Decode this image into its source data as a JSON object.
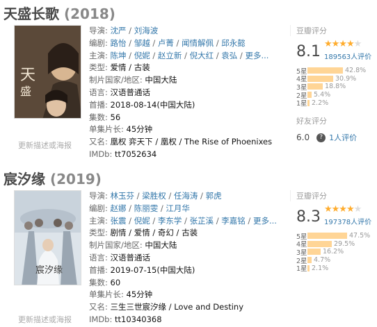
{
  "entries": [
    {
      "title": "天盛长歌",
      "year": "(2018)",
      "poster_link": "更新描述或海报",
      "director": {
        "label": "导演:",
        "names": [
          "沈严",
          "刘海波"
        ]
      },
      "writer": {
        "label": "编剧:",
        "names": [
          "路怡",
          "邹越",
          "卢菁",
          "闻情解佩",
          "邱永懿"
        ]
      },
      "cast": {
        "label": "主演:",
        "names": [
          "陈坤",
          "倪妮",
          "赵立新",
          "倪大红",
          "袁弘"
        ],
        "more": "更多..."
      },
      "genre": {
        "label": "类型:",
        "value": "爱情 / 古装"
      },
      "region": {
        "label": "制片国家/地区:",
        "value": "中国大陆"
      },
      "language": {
        "label": "语言:",
        "value": "汉语普通话"
      },
      "premiere": {
        "label": "首播:",
        "value": "2018-08-14(中国大陆)"
      },
      "episodes": {
        "label": "集数:",
        "value": "56"
      },
      "runtime": {
        "label": "单集片长:",
        "value": "45分钟"
      },
      "aka": {
        "label": "又名:",
        "value": "凰权 弈天下 / 凰权 / The Rise of Phoenixes"
      },
      "imdb": {
        "label": "IMDb:",
        "value": "tt7052634"
      },
      "rating": {
        "header": "豆瓣评分",
        "score": "8.1",
        "stars": 4,
        "votes": "189563人评价",
        "breakdown": [
          {
            "label": "5星",
            "pct": 42.8,
            "text": "42.8%"
          },
          {
            "label": "4星",
            "pct": 30.9,
            "text": "30.9%"
          },
          {
            "label": "3星",
            "pct": 18.8,
            "text": "18.8%"
          },
          {
            "label": "2星",
            "pct": 5.4,
            "text": "5.4%"
          },
          {
            "label": "1星",
            "pct": 2.2,
            "text": "2.2%"
          }
        ]
      },
      "friends": {
        "header": "好友评分",
        "score": "6.0",
        "count": "1人评价"
      },
      "colors": {
        "poster_bg": "#5a4a3a",
        "poster_accent": "#c9a27a"
      }
    },
    {
      "title": "宸汐缘",
      "year": "(2019)",
      "poster_link": "更新描述或海报",
      "director": {
        "label": "导演:",
        "names": [
          "林玉芬",
          "梁胜权",
          "任海涛",
          "郭虎"
        ]
      },
      "writer": {
        "label": "编剧:",
        "names": [
          "赵娜",
          "陈丽雯",
          "江月华"
        ]
      },
      "cast": {
        "label": "主演:",
        "names": [
          "张震",
          "倪妮",
          "李东学",
          "张芷溪",
          "李嘉铭"
        ],
        "more": "更多..."
      },
      "genre": {
        "label": "类型:",
        "value": "剧情 / 爱情 / 奇幻 / 古装"
      },
      "region": {
        "label": "制片国家/地区:",
        "value": "中国大陆"
      },
      "language": {
        "label": "语言:",
        "value": "汉语普通话"
      },
      "premiere": {
        "label": "首播:",
        "value": "2019-07-15(中国大陆)"
      },
      "episodes": {
        "label": "集数:",
        "value": "60"
      },
      "runtime": {
        "label": "单集片长:",
        "value": "45分钟"
      },
      "aka": {
        "label": "又名:",
        "value": "三生三世宸汐缘 / Love and Destiny"
      },
      "imdb": {
        "label": "IMDb:",
        "value": "tt10340368"
      },
      "rating": {
        "header": "豆瓣评分",
        "score": "8.3",
        "stars": 4,
        "votes": "197378人评价",
        "breakdown": [
          {
            "label": "5星",
            "pct": 47.5,
            "text": "47.5%"
          },
          {
            "label": "4星",
            "pct": 29.5,
            "text": "29.5%"
          },
          {
            "label": "3星",
            "pct": 16.2,
            "text": "16.2%"
          },
          {
            "label": "2星",
            "pct": 4.7,
            "text": "4.7%"
          },
          {
            "label": "1星",
            "pct": 2.1,
            "text": "2.1%"
          }
        ]
      },
      "colors": {
        "poster_bg": "#dfe7ee",
        "poster_accent": "#8a9aa8"
      }
    }
  ],
  "colors": {
    "link": "#3377aa",
    "star": "#ffac2d",
    "bar": "#ffd596",
    "label": "#666666"
  }
}
